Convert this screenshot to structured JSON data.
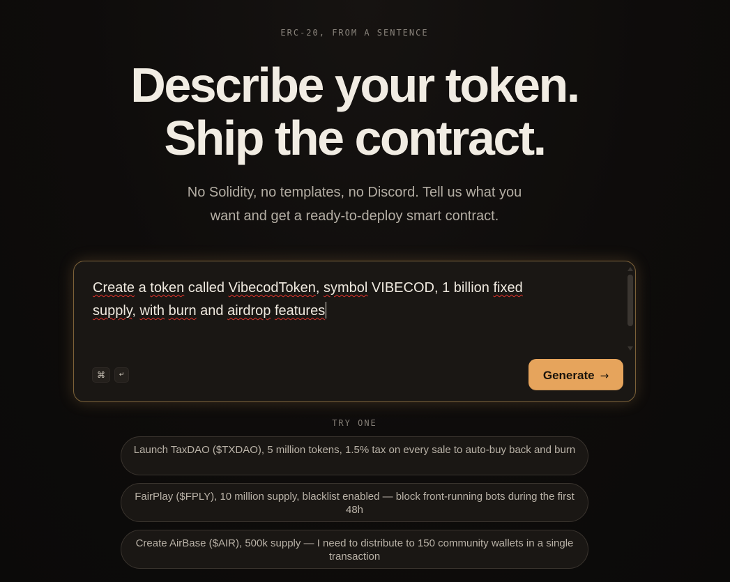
{
  "hero": {
    "eyebrow": "ERC-20, FROM A SENTENCE",
    "headline_line1": "Describe your token.",
    "headline_line2": "Ship the contract.",
    "subhead_line1": "No Solidity, no templates, no Discord. Tell us what you",
    "subhead_line2": "want and get a ready-to-deploy smart contract."
  },
  "composer": {
    "prompt_segments": {
      "s1": "Create",
      "s2": " a ",
      "s3": "token",
      "s4": " called ",
      "s5": "VibecodToken",
      "s6": ", ",
      "s7": "symbol",
      "s8": " VIBECOD, 1 billion ",
      "s9": "fixed",
      "s10": "supply",
      "s11": ", ",
      "s12": "with",
      "s13": " ",
      "s14": "burn",
      "s15": " and ",
      "s16": "airdrop",
      "s17": " ",
      "s18": "features"
    },
    "shortcut_key1": "⌘",
    "shortcut_key2": "↵",
    "generate_label": "Generate",
    "generate_arrow": "→"
  },
  "suggestions": {
    "label": "TRY ONE",
    "items": [
      "Launch TaxDAO ($TXDAO), 5 million tokens, 1.5% tax on every sale to auto-buy back and burn",
      "FairPlay ($FPLY), 10 million supply, blacklist enabled — block front-running bots during the first 48h",
      "Create AirBase ($AIR), 500k supply — I need to distribute to 150 community wallets in a single transaction"
    ]
  },
  "colors": {
    "background": "#0e0c0b",
    "accent": "#e6a45c",
    "heading": "#f1ece3",
    "spellcheck": "#e0322c"
  }
}
